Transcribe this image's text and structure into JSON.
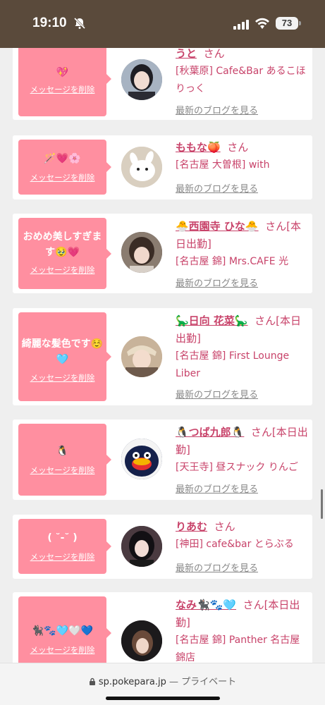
{
  "status": {
    "time": "19:10",
    "battery": "73"
  },
  "url_bar": {
    "domain": "sp.pokepara.jp",
    "mode": "— プライベート"
  },
  "cards": [
    {
      "message": "💖",
      "delete_label": "メッセージを削除",
      "name": "うと",
      "suffix": "さん",
      "shop": "[秋葉原] Cafe&Bar あるこほりっく",
      "blog_label": "最新のブログを見る"
    },
    {
      "message": "🪄💗🌸",
      "delete_label": "メッセージを削除",
      "name": "ももな🍑",
      "suffix": "さん",
      "shop": "[名古屋 大曽根] with",
      "blog_label": "最新のブログを見る"
    },
    {
      "message": "おめめ美しすぎます🥹💗",
      "delete_label": "メッセージを削除",
      "name": "🐣西園寺 ひな🐣",
      "suffix": "さん[本日出勤]",
      "shop": "[名古屋 錦] Mrs.CAFE 光",
      "blog_label": "最新のブログを見る"
    },
    {
      "message": "綺麗な髪色です☺️🩵",
      "delete_label": "メッセージを削除",
      "name": "🦕日向 花菜🦕",
      "suffix": "さん[本日出勤]",
      "shop": "[名古屋 錦] First Lounge Liber",
      "blog_label": "最新のブログを見る"
    },
    {
      "message": "🐧",
      "delete_label": "メッセージを削除",
      "name": "🐧つば九郎🐧",
      "suffix": "さん[本日出勤]",
      "shop": "[天王寺] 昼スナック りんご",
      "blog_label": "最新のブログを見る"
    },
    {
      "message": "( ˘-˘ )",
      "delete_label": "メッセージを削除",
      "name": "りあむ",
      "suffix": "さん",
      "shop": "[神田] cafe&bar とらぶる",
      "blog_label": "最新のブログを見る"
    },
    {
      "message": "🐈‍⬛🐾🩵🤍💙",
      "delete_label": "メッセージを削除",
      "name": "なみ🐈‍⬛🐾🩵",
      "suffix": "さん[本日出勤]",
      "shop": "[名古屋 錦] Panther 名古屋錦店",
      "blog_label": "最新のブログを見る"
    }
  ],
  "avatar_colors": [
    "#6b6f7a",
    "#d7cbb8",
    "#3c3530",
    "#c9a27a",
    "#1a2a5a",
    "#2b2024",
    "#1f1b1e"
  ]
}
